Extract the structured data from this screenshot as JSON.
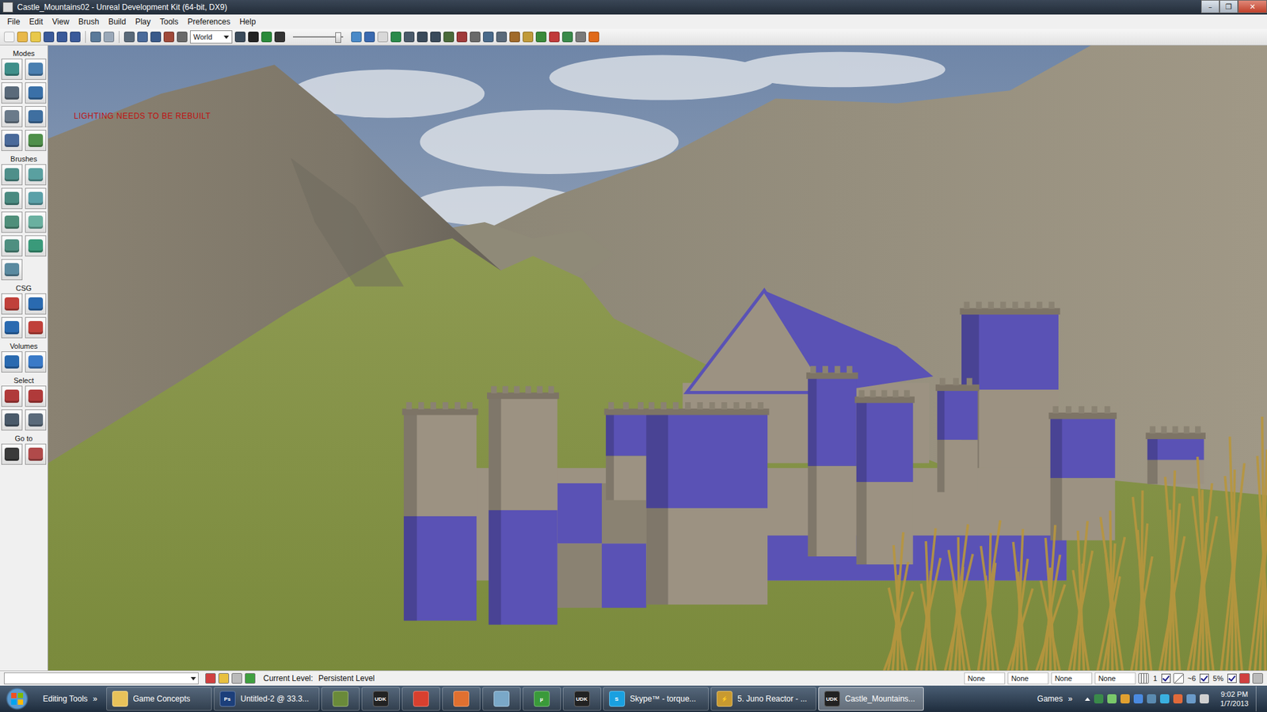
{
  "window": {
    "title": "Castle_Mountains02 - Unreal Development Kit (64-bit, DX9)",
    "controls": [
      "–",
      "❐",
      "✕"
    ]
  },
  "menu": [
    "File",
    "Edit",
    "View",
    "Brush",
    "Build",
    "Play",
    "Tools",
    "Preferences",
    "Help"
  ],
  "toolbar": {
    "dropdown": "World",
    "slider_level": 0.9
  },
  "left_panel": {
    "sections": [
      {
        "label": "Modes"
      },
      {
        "label": "Brushes"
      },
      {
        "label": "CSG"
      },
      {
        "label": "Volumes"
      },
      {
        "label": "Select"
      },
      {
        "label": "Go to"
      }
    ]
  },
  "viewport": {
    "warning": "LIGHTING NEEDS TO BE REBUILT"
  },
  "status_bar": {
    "level_label": "Current Level:",
    "level_name": "Persistent Level",
    "fields": [
      "None",
      "None",
      "None",
      "None"
    ],
    "grid": "1",
    "rotation": "~6",
    "scale": "5%",
    "toggles": [
      {
        "checked": true
      },
      {
        "checked": true
      },
      {
        "checked": true
      }
    ]
  },
  "taskbar": {
    "toolbar_label": "Editing Tools",
    "chevron": "»",
    "items": [
      {
        "kind": "button",
        "label": "Game Concepts",
        "selected": false,
        "color": "#e8c25a"
      },
      {
        "kind": "button",
        "label": "Untitled-2 @ 33.3...",
        "icon": "Ps",
        "selected": false,
        "color": "#1c3f7a"
      },
      {
        "kind": "icon",
        "selected": false,
        "color": "#6a8a3a"
      },
      {
        "kind": "icon",
        "icon": "UDK",
        "selected": false,
        "color": "#222222"
      },
      {
        "kind": "icon",
        "selected": false,
        "color": "#d8402f"
      },
      {
        "kind": "icon",
        "selected": false,
        "color": "#e07030"
      },
      {
        "kind": "icon",
        "selected": false,
        "color": "#7aa8c8"
      },
      {
        "kind": "icon",
        "icon": "µ",
        "selected": false,
        "color": "#3a9a3a"
      },
      {
        "kind": "icon",
        "icon": "UDK",
        "selected": false,
        "color": "#222222"
      },
      {
        "kind": "button",
        "label": "Skype™ - torque...",
        "icon": "S",
        "selected": false,
        "color": "#1aa0e0"
      },
      {
        "kind": "button",
        "label": "5. Juno Reactor - ...",
        "icon": "⚡",
        "selected": false,
        "color": "#c89a30"
      },
      {
        "kind": "button",
        "label": "Castle_Mountains...",
        "icon": "UDK",
        "selected": true,
        "color": "#222222"
      }
    ],
    "tray": {
      "label": "Games",
      "chevron": "»",
      "time": "9:02 PM",
      "date": "1/7/2013"
    }
  }
}
